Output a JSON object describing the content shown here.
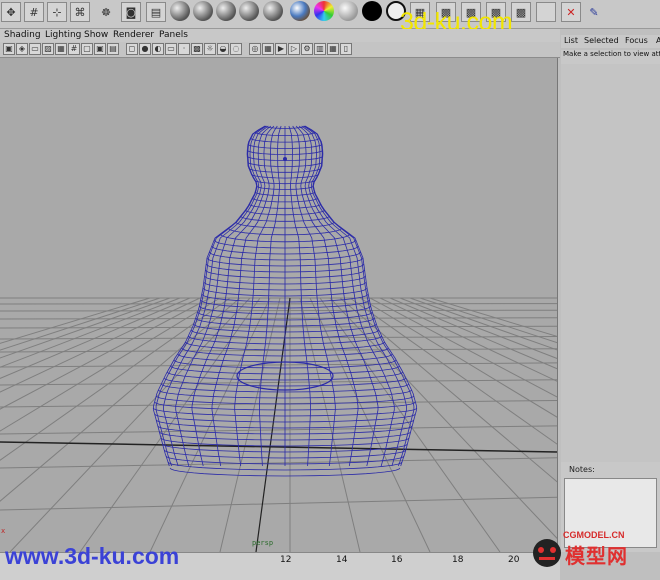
{
  "viewport_menu": {
    "shading": "Shading",
    "lighting": "Lighting",
    "show": "Show",
    "renderer": "Renderer",
    "panels": "Panels"
  },
  "right_panel": {
    "menu": {
      "list": "List",
      "selected": "Selected",
      "focus": "Focus",
      "attributes": "A"
    },
    "hint": "Make a selection to view attr",
    "notes_label": "Notes:"
  },
  "viewport": {
    "camera": "persp",
    "axis_label": "x"
  },
  "time_slider": {
    "ticks": [
      "12",
      "14",
      "16",
      "18",
      "20"
    ]
  },
  "watermarks": {
    "top": "3d-ku.com",
    "bottom": "www.3d-ku.com",
    "cg_site": "CGMODEL.CN",
    "cg_name": "模型网"
  },
  "colors": {
    "wireframe": "#2a2aa8",
    "grid": "#7f7f7f",
    "viewport_bg": "#a9a9a9",
    "watermark_yellow": "#f2e600",
    "watermark_blue": "#3b42d6"
  },
  "shelf_icons": [
    "move-icon",
    "grid-icon",
    "snap-icon",
    "curve-icon",
    "sphere-icon",
    "camera-icon",
    "graph-icon",
    "sphere-shaded-icon",
    "sphere-shaded-icon",
    "sphere-shaded-icon",
    "sphere-shaded-icon",
    "texture-sphere-icon",
    "color-sphere-icon",
    "gray-sphere-icon",
    "black-sphere-icon",
    "ring-icon",
    "clapper-icon",
    "render-icon",
    "render-icon",
    "render-icon",
    "render-icon",
    "blank-icon",
    "x-tool-icon",
    "brush-icon"
  ],
  "viewport_tools": [
    "select-camera-icon",
    "lock-icon",
    "camera-attr-icon",
    "bookmark-icon",
    "image-plane-icon",
    "grid-toggle-icon",
    "film-gate-icon",
    "resolution-gate-icon",
    "safe-action-icon",
    "wireframe-icon",
    "smooth-shade-icon",
    "flat-shade-icon",
    "bounding-box-icon",
    "points-icon",
    "textured-icon",
    "light-icon",
    "shadow-icon",
    "xray-icon",
    "isolate-icon",
    "hud-icon",
    "render-icon",
    "ipr-icon",
    "settings-icon",
    "panel-icon",
    "layout-icon",
    "two-panel-icon"
  ]
}
